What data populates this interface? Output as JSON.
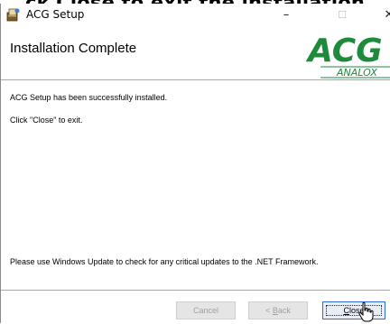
{
  "caption": "ck Close to exit the installation",
  "window": {
    "title": "ACG Setup"
  },
  "header": {
    "title": "Installation Complete",
    "logo": {
      "primary": "ACG",
      "secondary": "ANALOX",
      "color": "#1e8a3c"
    }
  },
  "body": {
    "line1": "ACG Setup has been successfully installed.",
    "line2": "Click \"Close\" to exit.",
    "line3": "Please use Windows Update to check for any critical updates to the .NET Framework."
  },
  "buttons": {
    "cancel": "Cancel",
    "back_prefix": "< ",
    "back_mnemonic": "B",
    "back_rest": "ack",
    "close_mnemonic": "C",
    "close_rest": "lose"
  },
  "caption_buttons": {
    "minimize": "–",
    "maximize": "☐",
    "close": "✕"
  },
  "icons": {
    "app": "installer-icon",
    "cursor": "hand-pointer-icon"
  }
}
